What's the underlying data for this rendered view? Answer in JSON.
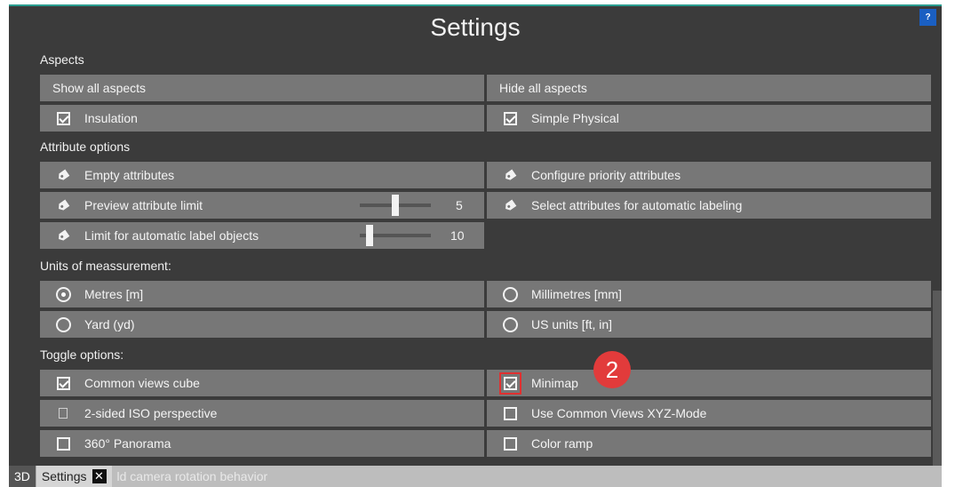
{
  "window": {
    "title": "Settings",
    "help_label": "?"
  },
  "aspects": {
    "heading": "Aspects",
    "show_all": "Show all aspects",
    "hide_all": "Hide all aspects",
    "insulation": "Insulation",
    "simple_physical": "Simple Physical"
  },
  "attributes": {
    "heading": "Attribute options",
    "empty": "Empty attributes",
    "configure_priority": "Configure priority attributes",
    "preview_limit": "Preview attribute limit",
    "preview_limit_value": "5",
    "select_auto_label": "Select attributes for automatic labeling",
    "auto_label_limit": "Limit for automatic label objects",
    "auto_label_limit_value": "10"
  },
  "units": {
    "heading": "Units of meassurement:",
    "metres": "Metres [m]",
    "millimetres": "Millimetres [mm]",
    "yard": "Yard (yd)",
    "us_units": "US units [ft, in]",
    "selected": "Metres [m]"
  },
  "toggles": {
    "heading": "Toggle options:",
    "common_views_cube": "Common views cube",
    "minimap": "Minimap",
    "iso_perspective": "2-sided ISO perspective",
    "xyz_mode": "Use Common Views XYZ-Mode",
    "panorama": "360° Panorama",
    "color_ramp": "Color ramp",
    "camera_rotation": "ld camera rotation behavior"
  },
  "callout": {
    "number": "2"
  },
  "tabs": {
    "tab_3d": "3D",
    "tab_settings": "Settings",
    "close_label": "✕"
  },
  "colors": {
    "panel": "#3b3b3b",
    "row": "#777777",
    "accent": "#2a9d8f",
    "help": "#1a5fc2",
    "badge": "#e23b3b"
  }
}
